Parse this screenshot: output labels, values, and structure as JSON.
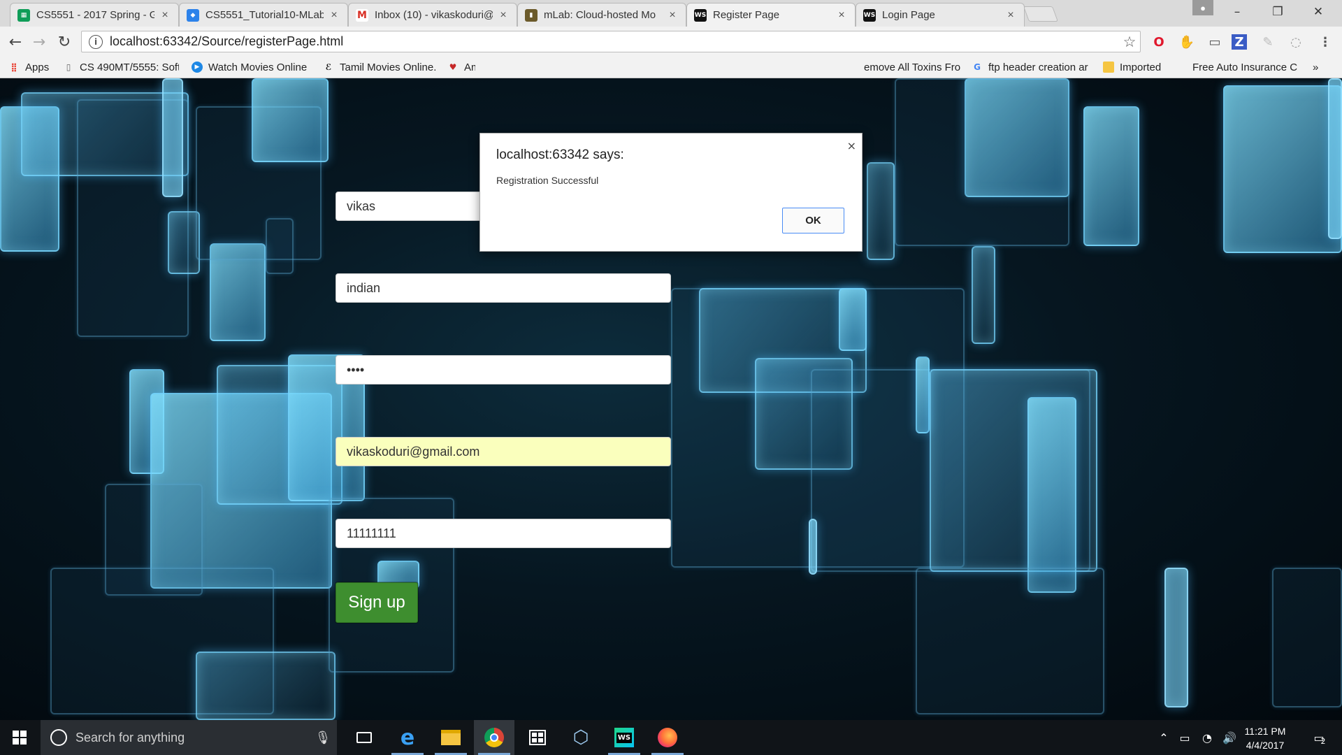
{
  "browser": {
    "tabs": [
      {
        "title": "CS5551 - 2017 Spring - G",
        "icon": "sheets-icon",
        "color": "#0f9d58",
        "active": false
      },
      {
        "title": "CS5551_Tutorial10-MLab",
        "icon": "dropbox-icon",
        "color": "#2c82ea",
        "active": false
      },
      {
        "title": "Inbox (10) - vikaskoduri@",
        "icon": "gmail-icon",
        "color": "#d93025",
        "active": false
      },
      {
        "title": "mLab: Cloud-hosted Mo",
        "icon": "mlab-icon",
        "color": "#6b5a2a",
        "active": false
      },
      {
        "title": "Register Page",
        "icon": "webstorm-icon",
        "color": "#111111",
        "active": true
      },
      {
        "title": "Login Page",
        "icon": "webstorm-icon",
        "color": "#111111",
        "active": false
      }
    ],
    "address": "localhost:63342/Source/registerPage.html",
    "bookmarks": [
      {
        "label": "Apps",
        "icon": "apps-grid-icon"
      },
      {
        "label": "CS 490MT/5555: Softv",
        "icon": "page-icon"
      },
      {
        "label": "Watch Movies Online",
        "icon": "play-circle-icon"
      },
      {
        "label": "Tamil Movies Online.",
        "icon": "script-e-icon"
      },
      {
        "label": "Am",
        "icon": "heart-shield-icon"
      },
      {
        "label": "emove All Toxins Fro",
        "icon": "none"
      },
      {
        "label": "ftp header creation ar",
        "icon": "google-g-icon"
      },
      {
        "label": "Imported",
        "icon": "folder-icon"
      },
      {
        "label": "Free Auto Insurance C",
        "icon": "none"
      },
      {
        "label": "»",
        "icon": "none"
      }
    ]
  },
  "form": {
    "first_value": "vikas",
    "second_value": "indian",
    "password_value": "••••",
    "email_value": "vikaskoduri@gmail.com",
    "phone_value": "11111111",
    "signup_label": "Sign up"
  },
  "alert": {
    "title": "localhost:63342 says:",
    "message": "Registration Successful",
    "ok_label": "OK",
    "close_glyph": "×"
  },
  "taskbar": {
    "search_placeholder": "Search for anything",
    "time": "11:21 PM",
    "date": "4/4/2017",
    "notification_count": "2",
    "apps": [
      "task-view-icon",
      "edge-icon",
      "file-explorer-icon",
      "chrome-icon",
      "store-icon",
      "virtualbox-icon",
      "webstorm-icon",
      "firefox-icon"
    ]
  },
  "colors": {
    "signup_button": "#3e8e2f",
    "autofill_field": "#faffbd",
    "glass_accent": "#78d7ff",
    "ok_focus_border": "#4a8cf5"
  }
}
